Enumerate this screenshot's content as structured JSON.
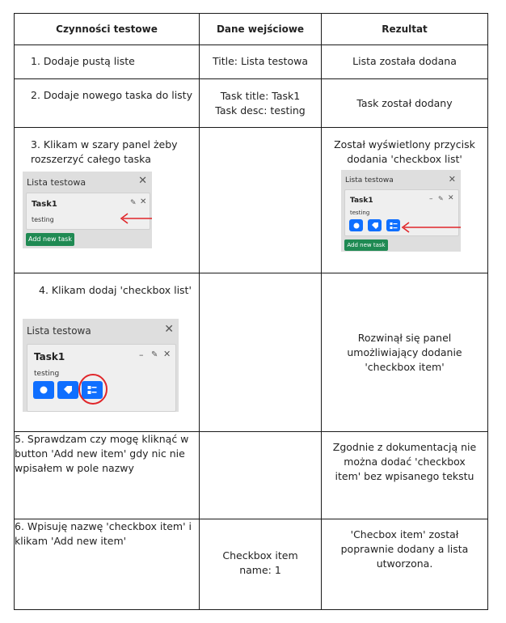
{
  "headers": [
    "Czynności testowe",
    "Dane wejściowe",
    "Rezultat"
  ],
  "rows": [
    {
      "step": "1. Dodaje pustą liste",
      "input": "Title: Lista testowa",
      "result": "Lista została dodana"
    },
    {
      "step": "2. Dodaje nowego taska do listy",
      "input_line1": "Task title: Task1",
      "input_line2": "Task desc: testing",
      "result": "Task został dodany"
    },
    {
      "step": "3. Klikam w szary panel żeby rozszerzyć całego taska",
      "input": "",
      "result": "Został wyświetlony przycisk dodania 'checkbox list'"
    },
    {
      "step": "4. Klikam dodaj 'checkbox list'",
      "input": "",
      "result": "Rozwinął się panel umożliwiający dodanie 'checkbox item'"
    },
    {
      "step": "5. Sprawdzam czy mogę kliknąć w button 'Add new item' gdy nic nie wpisałem w pole nazwy",
      "input": "",
      "result": "Zgodnie z dokumentacją nie można dodać 'checkbox item' bez wpisanego tekstu"
    },
    {
      "step": "6. Wpisuję nazwę 'checkbox item' i klikam 'Add new item'",
      "input": "Checkbox item name: 1",
      "result": "'Checbox item' został poprawnie dodany a lista utworzona."
    }
  ],
  "mock": {
    "list_title": "Lista testowa",
    "task_name": "Task1",
    "task_desc": "testing",
    "add_task_label": "Add new task"
  },
  "colors": {
    "arrow": "#e0262a",
    "circle": "#e0262a",
    "button_blue": "#0f6fff",
    "button_green": "#1f8a53"
  }
}
